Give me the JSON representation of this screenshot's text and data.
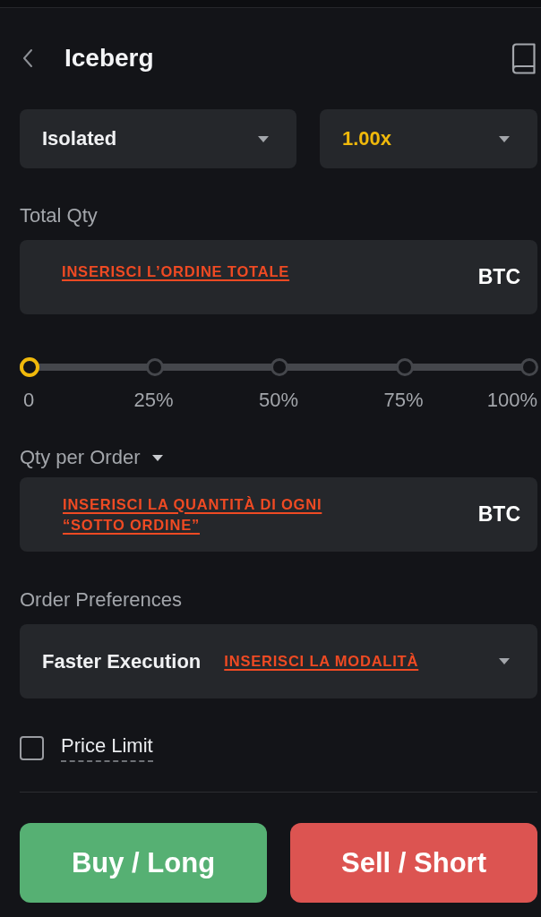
{
  "header": {
    "title": "Iceberg"
  },
  "selectors": [
    {
      "kind": "margin",
      "value": "Isolated"
    },
    {
      "kind": "leverage",
      "value": "1.00x"
    }
  ],
  "total_qty": {
    "label": "Total Qty",
    "unit": "BTC",
    "annotation": "INSERISCI L’ORDINE TOTALE"
  },
  "slider": {
    "level": 0,
    "ticks": [
      "0",
      "25%",
      "50%",
      "75%",
      "100%"
    ]
  },
  "qty_per_order": {
    "label": "Qty per Order",
    "unit": "BTC",
    "annotation": "INSERISCI LA QUANTITÀ DI OGNI “SOTTO ORDINE”"
  },
  "order_preferences": {
    "label": "Order Preferences",
    "value": "Faster Execution",
    "annotation": "INSERISCI LA MODALITÀ"
  },
  "price_limit": {
    "label": "Price Limit",
    "checked": false
  },
  "actions": [
    {
      "kind": "buy",
      "label": "Buy / Long"
    },
    {
      "kind": "sell",
      "label": "Sell / Short"
    }
  ]
}
